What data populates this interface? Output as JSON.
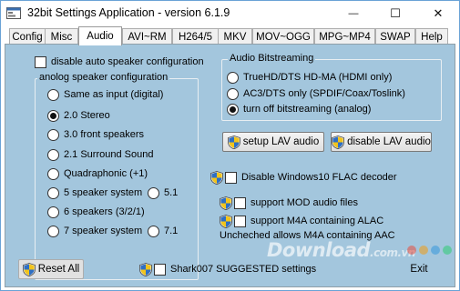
{
  "window": {
    "title": "32bit Settings Application - version 6.1.9",
    "minimize_glyph": "—",
    "maximize_glyph": "☐",
    "close_glyph": "✕"
  },
  "tabs": [
    {
      "label": "Config",
      "active": false
    },
    {
      "label": "Misc",
      "active": false
    },
    {
      "label": "Audio",
      "active": true
    },
    {
      "label": "AVI~RM",
      "active": false
    },
    {
      "label": "H264/5",
      "active": false
    },
    {
      "label": "MKV",
      "active": false
    },
    {
      "label": "MOV~OGG",
      "active": false
    },
    {
      "label": "MPG~MP4",
      "active": false
    },
    {
      "label": "SWAP",
      "active": false
    },
    {
      "label": "Help",
      "active": false
    }
  ],
  "audio": {
    "disable_auto": {
      "label": "disable auto speaker configuration",
      "checked": false
    },
    "analog_group": {
      "title": "anolog speaker configuration",
      "options": [
        {
          "label": "Same as input (digital)",
          "selected": false
        },
        {
          "label": "2.0 Stereo",
          "selected": true
        },
        {
          "label": "3.0 front speakers",
          "selected": false
        },
        {
          "label": "2.1 Surround Sound",
          "selected": false
        },
        {
          "label": "Quadraphonic (+1)",
          "selected": false
        },
        {
          "label": "5 speaker system",
          "selected": false
        },
        {
          "label": "6 speakers (3/2/1)",
          "selected": false
        },
        {
          "label": "7 speaker system",
          "selected": false
        }
      ],
      "side_options": [
        {
          "label": "5.1",
          "selected": false
        },
        {
          "label": "7.1",
          "selected": false
        }
      ]
    },
    "bitstream_group": {
      "title": "Audio Bitstreaming",
      "options": [
        {
          "label": "TrueHD/DTS HD-MA (HDMI only)",
          "selected": false
        },
        {
          "label": "AC3/DTS only (SPDIF/Coax/Toslink)",
          "selected": false
        },
        {
          "label": "turn off bitstreaming (analog)",
          "selected": true
        }
      ]
    },
    "setup_lav_label": "setup LAV audio",
    "disable_lav_label": "disable LAV audio",
    "flac": {
      "label": "Disable Windows10 FLAC decoder",
      "checked": false
    },
    "mod": {
      "label": "support MOD audio files",
      "checked": false
    },
    "m4a": {
      "label": "support M4A containing ALAC",
      "checked": false
    },
    "m4a_note": "Uncheched allows M4A containing AAC"
  },
  "footer": {
    "reset_label": "Reset All",
    "shark_label": "Shark007 SUGGESTED settings",
    "shark_checked": false,
    "exit_label": "Exit"
  },
  "watermark": {
    "text": "Download",
    "tld": ".com.vn"
  },
  "colors": {
    "panel_bg": "#a3c6dd",
    "shield_blue": "#2f6fc3",
    "shield_yellow": "#f2c41b",
    "window_border": "#6aa2d6"
  },
  "icons": {
    "app": "app-icon",
    "uac_shield": "uac-shield-icon"
  }
}
